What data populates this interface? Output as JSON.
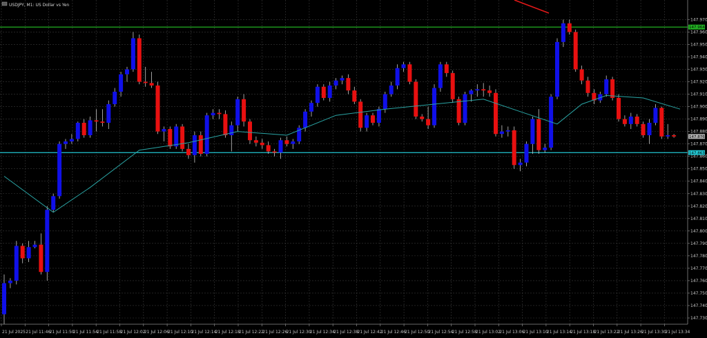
{
  "header": {
    "title": "USDJPY, M1:  US Dollar vs Yen"
  },
  "colors": {
    "background": "#000000",
    "grid": "#3a3a3a",
    "bull": "#1010e8",
    "bear": "#e81010",
    "wick": "#c8c8c8",
    "ma": "#2aa5a5",
    "resistance": "#22b022",
    "support": "#22c5d0",
    "trend": "#e01818"
  },
  "chart_data": {
    "type": "candlestick",
    "symbol": "USDJPY",
    "timeframe": "M1",
    "ylim": [
      147.725,
      147.978
    ],
    "y_ticks": [
      "147.970",
      "147.960",
      "147.950",
      "147.940",
      "147.930",
      "147.920",
      "147.910",
      "147.900",
      "147.890",
      "147.880",
      "147.870",
      "147.860",
      "147.850",
      "147.840",
      "147.830",
      "147.820",
      "147.810",
      "147.800",
      "147.790",
      "147.780",
      "147.770",
      "147.760",
      "147.750",
      "147.740",
      "147.730"
    ],
    "x_labels": [
      "21 Jul 2025",
      "21 Jul 11:46",
      "21 Jul 11:50",
      "21 Jul 11:54",
      "21 Jul 11:58",
      "21 Jul 12:02",
      "21 Jul 12:06",
      "21 Jul 12:10",
      "21 Jul 12:14",
      "21 Jul 12:18",
      "21 Jul 12:22",
      "21 Jul 12:26",
      "21 Jul 12:30",
      "21 Jul 12:34",
      "21 Jul 12:38",
      "21 Jul 12:42",
      "21 Jul 12:46",
      "21 Jul 12:50",
      "21 Jul 12:54",
      "21 Jul 12:58",
      "21 Jul 13:02",
      "21 Jul 13:06",
      "21 Jul 13:10",
      "21 Jul 13:14",
      "21 Jul 13:18",
      "21 Jul 13:22",
      "21 Jul 13:26",
      "21 Jul 13:30",
      "21 Jul 13:34"
    ],
    "candles": [
      {
        "o": 147.733,
        "h": 147.765,
        "l": 147.725,
        "c": 147.758
      },
      {
        "o": 147.758,
        "h": 147.762,
        "l": 147.754,
        "c": 147.76
      },
      {
        "o": 147.76,
        "h": 147.792,
        "l": 147.757,
        "c": 147.788
      },
      {
        "o": 147.788,
        "h": 147.79,
        "l": 147.774,
        "c": 147.778
      },
      {
        "o": 147.778,
        "h": 147.792,
        "l": 147.775,
        "c": 147.787
      },
      {
        "o": 147.787,
        "h": 147.792,
        "l": 147.786,
        "c": 147.789
      },
      {
        "o": 147.789,
        "h": 147.798,
        "l": 147.765,
        "c": 147.767
      },
      {
        "o": 147.767,
        "h": 147.82,
        "l": 147.76,
        "c": 147.817
      },
      {
        "o": 147.817,
        "h": 147.83,
        "l": 147.815,
        "c": 147.828
      },
      {
        "o": 147.828,
        "h": 147.872,
        "l": 147.826,
        "c": 147.87
      },
      {
        "o": 147.87,
        "h": 147.874,
        "l": 147.866,
        "c": 147.872
      },
      {
        "o": 147.872,
        "h": 147.878,
        "l": 147.87,
        "c": 147.874
      },
      {
        "o": 147.874,
        "h": 147.888,
        "l": 147.872,
        "c": 147.887
      },
      {
        "o": 147.887,
        "h": 147.89,
        "l": 147.875,
        "c": 147.877
      },
      {
        "o": 147.877,
        "h": 147.892,
        "l": 147.875,
        "c": 147.889
      },
      {
        "o": 147.889,
        "h": 147.898,
        "l": 147.88,
        "c": 147.888
      },
      {
        "o": 147.888,
        "h": 147.898,
        "l": 147.884,
        "c": 147.887
      },
      {
        "o": 147.887,
        "h": 147.905,
        "l": 147.882,
        "c": 147.902
      },
      {
        "o": 147.902,
        "h": 147.915,
        "l": 147.9,
        "c": 147.912
      },
      {
        "o": 147.912,
        "h": 147.928,
        "l": 147.908,
        "c": 147.926
      },
      {
        "o": 147.926,
        "h": 147.932,
        "l": 147.92,
        "c": 147.93
      },
      {
        "o": 147.93,
        "h": 147.96,
        "l": 147.928,
        "c": 147.955
      },
      {
        "o": 147.955,
        "h": 147.958,
        "l": 147.918,
        "c": 147.92
      },
      {
        "o": 147.92,
        "h": 147.932,
        "l": 147.916,
        "c": 147.919
      },
      {
        "o": 147.919,
        "h": 147.928,
        "l": 147.915,
        "c": 147.917
      },
      {
        "o": 147.917,
        "h": 147.92,
        "l": 147.878,
        "c": 147.88
      },
      {
        "o": 147.88,
        "h": 147.884,
        "l": 147.872,
        "c": 147.882
      },
      {
        "o": 147.882,
        "h": 147.884,
        "l": 147.866,
        "c": 147.868
      },
      {
        "o": 147.868,
        "h": 147.886,
        "l": 147.866,
        "c": 147.884
      },
      {
        "o": 147.884,
        "h": 147.886,
        "l": 147.864,
        "c": 147.866
      },
      {
        "o": 147.866,
        "h": 147.87,
        "l": 147.858,
        "c": 147.861
      },
      {
        "o": 147.861,
        "h": 147.88,
        "l": 147.855,
        "c": 147.877
      },
      {
        "o": 147.877,
        "h": 147.88,
        "l": 147.86,
        "c": 147.862
      },
      {
        "o": 147.862,
        "h": 147.895,
        "l": 147.86,
        "c": 147.893
      },
      {
        "o": 147.893,
        "h": 147.898,
        "l": 147.89,
        "c": 147.895
      },
      {
        "o": 147.895,
        "h": 147.898,
        "l": 147.89,
        "c": 147.894
      },
      {
        "o": 147.894,
        "h": 147.897,
        "l": 147.875,
        "c": 147.877
      },
      {
        "o": 147.877,
        "h": 147.888,
        "l": 147.864,
        "c": 147.885
      },
      {
        "o": 147.885,
        "h": 147.908,
        "l": 147.88,
        "c": 147.906
      },
      {
        "o": 147.906,
        "h": 147.91,
        "l": 147.884,
        "c": 147.888
      },
      {
        "o": 147.888,
        "h": 147.89,
        "l": 147.87,
        "c": 147.873
      },
      {
        "o": 147.873,
        "h": 147.876,
        "l": 147.868,
        "c": 147.871
      },
      {
        "o": 147.871,
        "h": 147.874,
        "l": 147.866,
        "c": 147.869
      },
      {
        "o": 147.869,
        "h": 147.872,
        "l": 147.862,
        "c": 147.864
      },
      {
        "o": 147.864,
        "h": 147.866,
        "l": 147.86,
        "c": 147.863
      },
      {
        "o": 147.863,
        "h": 147.875,
        "l": 147.858,
        "c": 147.873
      },
      {
        "o": 147.873,
        "h": 147.876,
        "l": 147.868,
        "c": 147.87
      },
      {
        "o": 147.87,
        "h": 147.874,
        "l": 147.866,
        "c": 147.872
      },
      {
        "o": 147.872,
        "h": 147.885,
        "l": 147.87,
        "c": 147.883
      },
      {
        "o": 147.883,
        "h": 147.898,
        "l": 147.88,
        "c": 147.896
      },
      {
        "o": 147.896,
        "h": 147.905,
        "l": 147.892,
        "c": 147.903
      },
      {
        "o": 147.903,
        "h": 147.918,
        "l": 147.9,
        "c": 147.916
      },
      {
        "o": 147.916,
        "h": 147.918,
        "l": 147.905,
        "c": 147.907
      },
      {
        "o": 147.907,
        "h": 147.92,
        "l": 147.904,
        "c": 147.917
      },
      {
        "o": 147.917,
        "h": 147.923,
        "l": 147.914,
        "c": 147.921
      },
      {
        "o": 147.921,
        "h": 147.925,
        "l": 147.918,
        "c": 147.923
      },
      {
        "o": 147.923,
        "h": 147.926,
        "l": 147.91,
        "c": 147.913
      },
      {
        "o": 147.913,
        "h": 147.916,
        "l": 147.902,
        "c": 147.904
      },
      {
        "o": 147.904,
        "h": 147.906,
        "l": 147.88,
        "c": 147.883
      },
      {
        "o": 147.883,
        "h": 147.895,
        "l": 147.88,
        "c": 147.893
      },
      {
        "o": 147.893,
        "h": 147.895,
        "l": 147.885,
        "c": 147.887
      },
      {
        "o": 147.887,
        "h": 147.9,
        "l": 147.884,
        "c": 147.898
      },
      {
        "o": 147.898,
        "h": 147.912,
        "l": 147.895,
        "c": 147.91
      },
      {
        "o": 147.91,
        "h": 147.92,
        "l": 147.908,
        "c": 147.917
      },
      {
        "o": 147.917,
        "h": 147.934,
        "l": 147.914,
        "c": 147.931
      },
      {
        "o": 147.931,
        "h": 147.936,
        "l": 147.928,
        "c": 147.934
      },
      {
        "o": 147.934,
        "h": 147.936,
        "l": 147.918,
        "c": 147.92
      },
      {
        "o": 147.92,
        "h": 147.922,
        "l": 147.89,
        "c": 147.892
      },
      {
        "o": 147.892,
        "h": 147.894,
        "l": 147.888,
        "c": 147.89
      },
      {
        "o": 147.89,
        "h": 147.9,
        "l": 147.882,
        "c": 147.885
      },
      {
        "o": 147.885,
        "h": 147.918,
        "l": 147.883,
        "c": 147.915
      },
      {
        "o": 147.915,
        "h": 147.936,
        "l": 147.912,
        "c": 147.934
      },
      {
        "o": 147.934,
        "h": 147.936,
        "l": 147.924,
        "c": 147.927
      },
      {
        "o": 147.927,
        "h": 147.929,
        "l": 147.903,
        "c": 147.906
      },
      {
        "o": 147.906,
        "h": 147.908,
        "l": 147.885,
        "c": 147.887
      },
      {
        "o": 147.887,
        "h": 147.912,
        "l": 147.885,
        "c": 147.91
      },
      {
        "o": 147.91,
        "h": 147.914,
        "l": 147.904,
        "c": 147.913
      },
      {
        "o": 147.913,
        "h": 147.918,
        "l": 147.908,
        "c": 147.914
      },
      {
        "o": 147.914,
        "h": 147.919,
        "l": 147.908,
        "c": 147.913
      },
      {
        "o": 147.913,
        "h": 147.917,
        "l": 147.908,
        "c": 147.911
      },
      {
        "o": 147.911,
        "h": 147.914,
        "l": 147.876,
        "c": 147.878
      },
      {
        "o": 147.878,
        "h": 147.885,
        "l": 147.875,
        "c": 147.88
      },
      {
        "o": 147.88,
        "h": 147.884,
        "l": 147.876,
        "c": 147.881
      },
      {
        "o": 147.881,
        "h": 147.884,
        "l": 147.85,
        "c": 147.853
      },
      {
        "o": 147.853,
        "h": 147.858,
        "l": 147.848,
        "c": 147.855
      },
      {
        "o": 147.855,
        "h": 147.872,
        "l": 147.852,
        "c": 147.87
      },
      {
        "o": 147.87,
        "h": 147.892,
        "l": 147.862,
        "c": 147.89
      },
      {
        "o": 147.89,
        "h": 147.898,
        "l": 147.862,
        "c": 147.865
      },
      {
        "o": 147.865,
        "h": 147.87,
        "l": 147.863,
        "c": 147.867
      },
      {
        "o": 147.867,
        "h": 147.91,
        "l": 147.865,
        "c": 147.908
      },
      {
        "o": 147.908,
        "h": 147.955,
        "l": 147.906,
        "c": 147.952
      },
      {
        "o": 147.952,
        "h": 147.97,
        "l": 147.948,
        "c": 147.967
      },
      {
        "o": 147.967,
        "h": 147.97,
        "l": 147.958,
        "c": 147.96
      },
      {
        "o": 147.96,
        "h": 147.962,
        "l": 147.928,
        "c": 147.93
      },
      {
        "o": 147.93,
        "h": 147.933,
        "l": 147.918,
        "c": 147.921
      },
      {
        "o": 147.921,
        "h": 147.924,
        "l": 147.908,
        "c": 147.911
      },
      {
        "o": 147.911,
        "h": 147.914,
        "l": 147.902,
        "c": 147.905
      },
      {
        "o": 147.905,
        "h": 147.912,
        "l": 147.903,
        "c": 147.91
      },
      {
        "o": 147.91,
        "h": 147.925,
        "l": 147.908,
        "c": 147.922
      },
      {
        "o": 147.922,
        "h": 147.924,
        "l": 147.905,
        "c": 147.907
      },
      {
        "o": 147.907,
        "h": 147.91,
        "l": 147.888,
        "c": 147.89
      },
      {
        "o": 147.89,
        "h": 147.893,
        "l": 147.884,
        "c": 147.886
      },
      {
        "o": 147.886,
        "h": 147.895,
        "l": 147.882,
        "c": 147.892
      },
      {
        "o": 147.892,
        "h": 147.894,
        "l": 147.884,
        "c": 147.886
      },
      {
        "o": 147.886,
        "h": 147.888,
        "l": 147.875,
        "c": 147.877
      },
      {
        "o": 147.877,
        "h": 147.89,
        "l": 147.87,
        "c": 147.887
      },
      {
        "o": 147.887,
        "h": 147.902,
        "l": 147.885,
        "c": 147.899
      },
      {
        "o": 147.899,
        "h": 147.9,
        "l": 147.874,
        "c": 147.876
      },
      {
        "o": 147.876,
        "h": 147.886,
        "l": 147.874,
        "c": 147.877
      },
      {
        "o": 147.877,
        "h": 147.878,
        "l": 147.875,
        "c": 147.876
      }
    ],
    "ma": [
      [
        0,
        147.844
      ],
      [
        8,
        147.815
      ],
      [
        14,
        147.835
      ],
      [
        22,
        147.865
      ],
      [
        30,
        147.871
      ],
      [
        38,
        147.88
      ],
      [
        46,
        147.877
      ],
      [
        54,
        147.893
      ],
      [
        62,
        147.898
      ],
      [
        70,
        147.902
      ],
      [
        78,
        147.906
      ],
      [
        84,
        147.896
      ],
      [
        90,
        147.886
      ],
      [
        94,
        147.902
      ],
      [
        98,
        147.909
      ],
      [
        104,
        147.907
      ],
      [
        110,
        147.898
      ]
    ],
    "levels": [
      {
        "name": "resistance",
        "value": 147.964,
        "label": "147.964"
      },
      {
        "name": "support",
        "value": 147.863,
        "label": "147.863"
      }
    ],
    "current_price": {
      "value": 147.876,
      "label": "147.876"
    }
  }
}
